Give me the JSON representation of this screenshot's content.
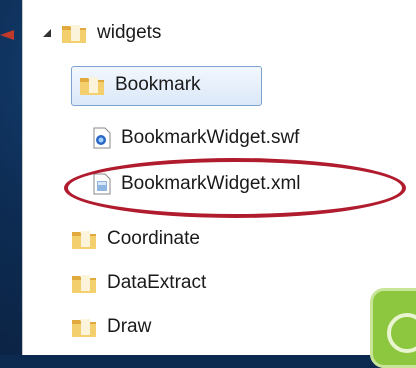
{
  "tree": {
    "root": {
      "label": "widgets",
      "icon": "folder-icon",
      "expanded": true
    },
    "selected_folder": {
      "label": "Bookmark",
      "icon": "folder-icon"
    },
    "files": [
      {
        "label": "BookmarkWidget.swf",
        "icon": "swf-file-icon"
      },
      {
        "label": "BookmarkWidget.xml",
        "icon": "xml-file-icon",
        "highlighted": true
      }
    ],
    "folders": [
      {
        "label": "Coordinate",
        "icon": "folder-icon"
      },
      {
        "label": "DataExtract",
        "icon": "folder-icon"
      },
      {
        "label": "Draw",
        "icon": "folder-icon"
      }
    ]
  },
  "colors": {
    "background": "#0c2a4f",
    "highlight_ellipse": "#b01c2e",
    "selection_border": "#7da2ce",
    "folder": "#e8b84a",
    "corner_shape": "#8dc63f"
  }
}
